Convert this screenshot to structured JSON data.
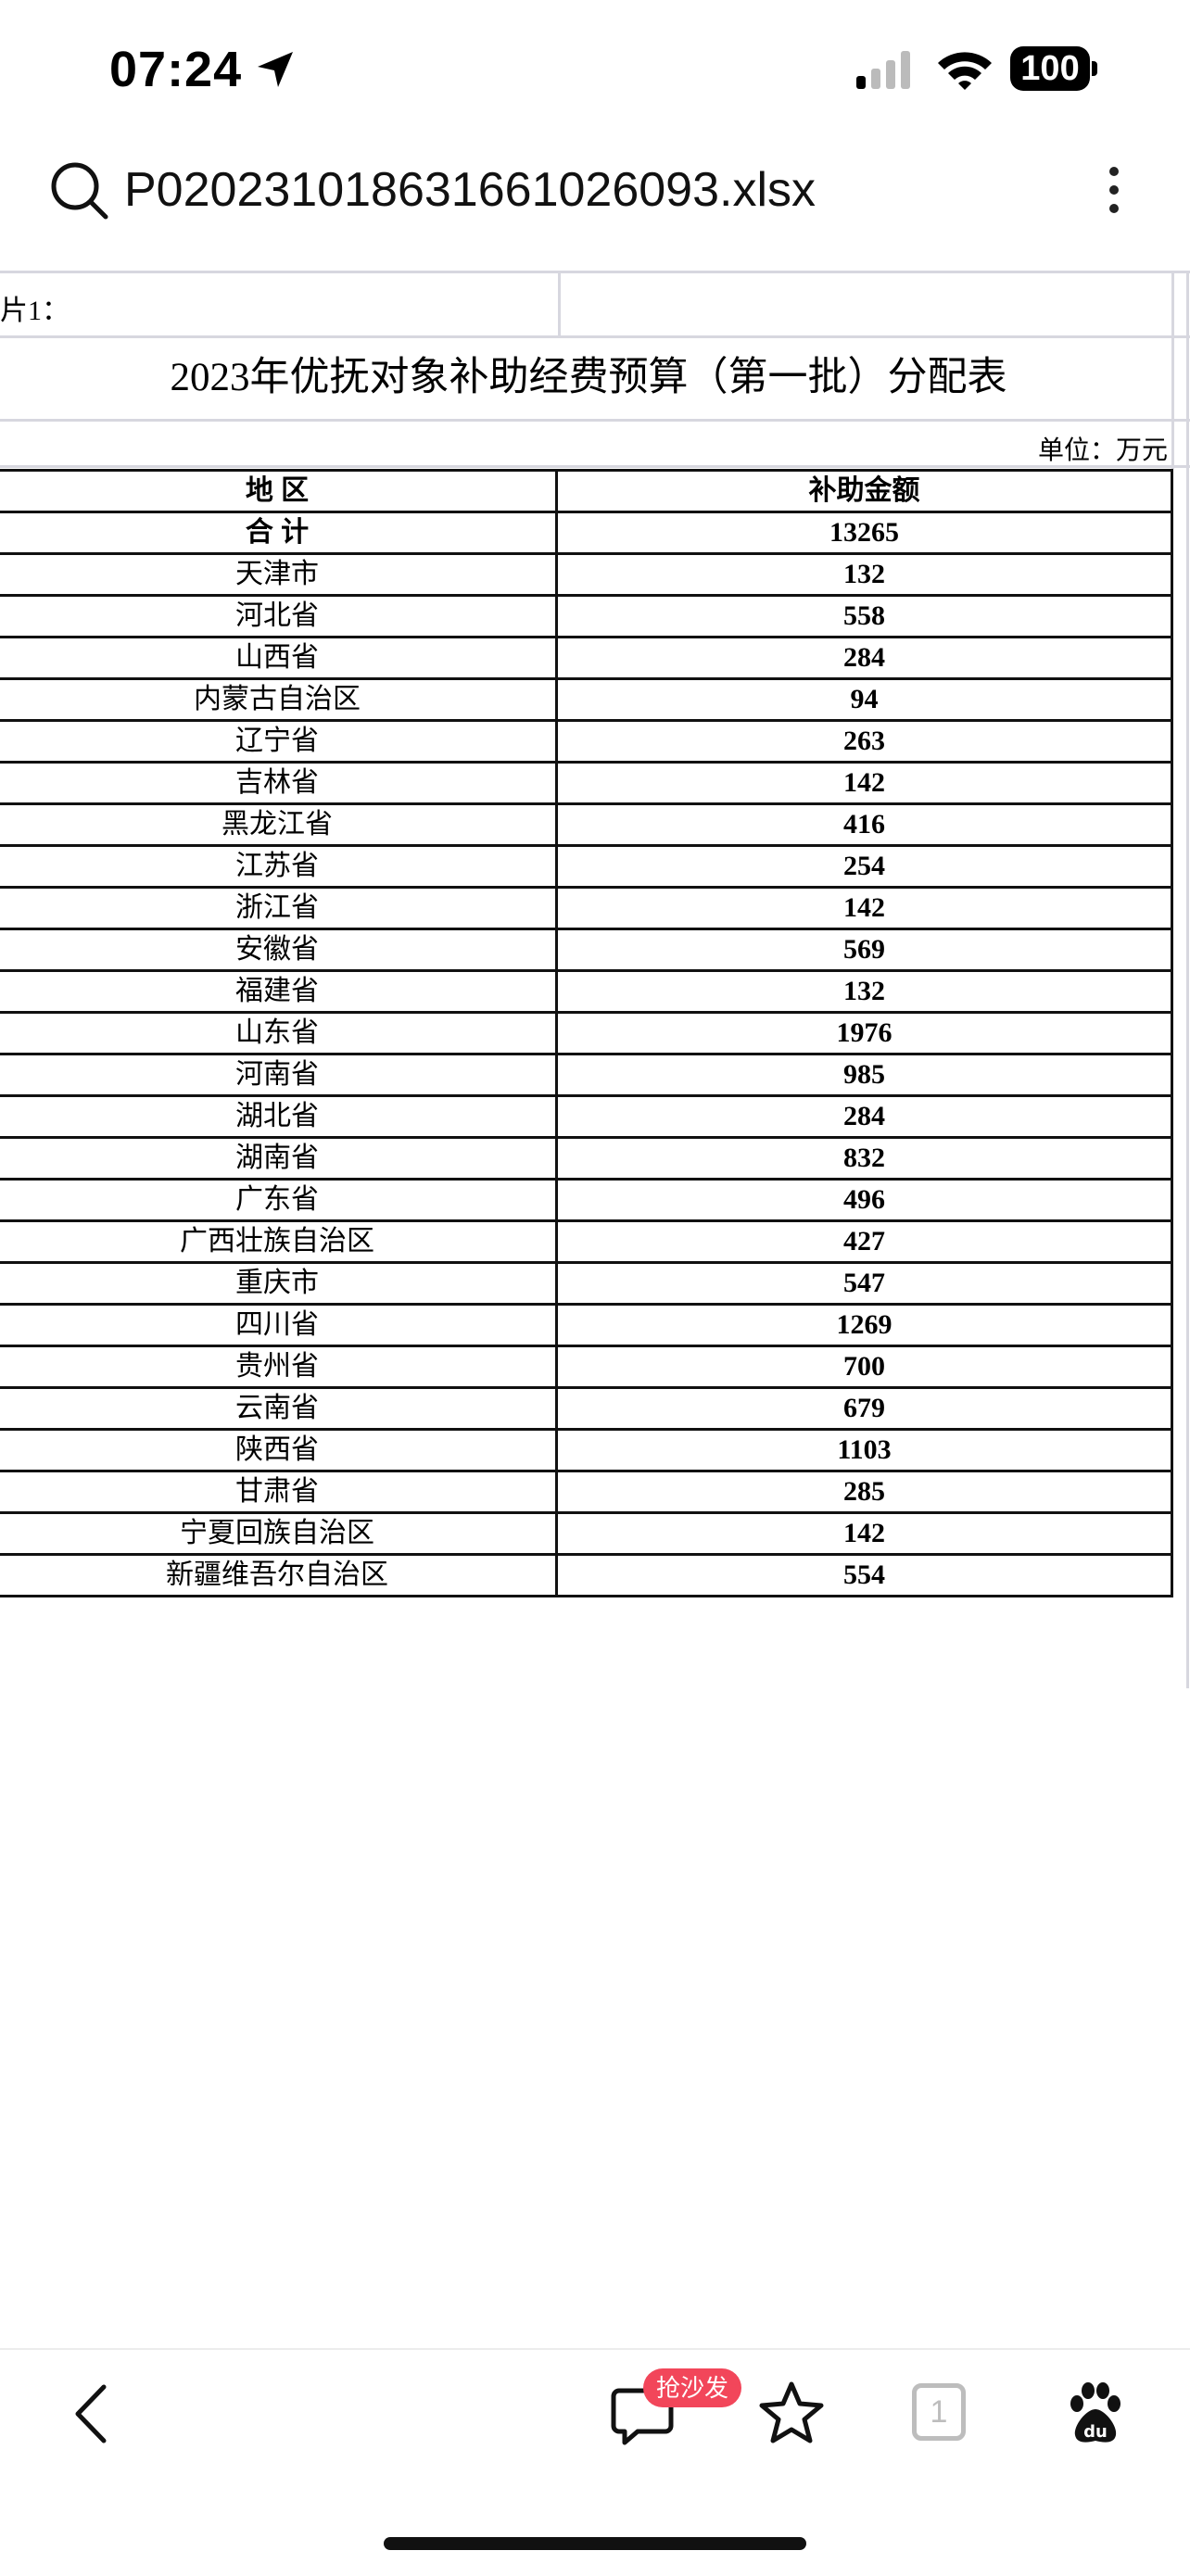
{
  "status_bar": {
    "time": "07:24",
    "battery": "100"
  },
  "address_bar": {
    "file_name": "P020231018631661026093.xlsx"
  },
  "sheet": {
    "note": "⽚1：",
    "title": "2023年优抚对象补助经费预算（第一批）分配表",
    "unit": "单位：万元",
    "headers": [
      "地 区",
      "补助金额"
    ],
    "total": {
      "label": "合 计",
      "value": "13265"
    },
    "rows": [
      {
        "region": "天津市",
        "amount": "132"
      },
      {
        "region": "河北省",
        "amount": "558"
      },
      {
        "region": "山西省",
        "amount": "284"
      },
      {
        "region": "内蒙古自治区",
        "amount": "94"
      },
      {
        "region": "辽宁省",
        "amount": "263"
      },
      {
        "region": "吉林省",
        "amount": "142"
      },
      {
        "region": "黑龙江省",
        "amount": "416"
      },
      {
        "region": "江苏省",
        "amount": "254"
      },
      {
        "region": "浙江省",
        "amount": "142"
      },
      {
        "region": "安徽省",
        "amount": "569"
      },
      {
        "region": "福建省",
        "amount": "132"
      },
      {
        "region": "山东省",
        "amount": "1976"
      },
      {
        "region": "河南省",
        "amount": "985"
      },
      {
        "region": "湖北省",
        "amount": "284"
      },
      {
        "region": "湖南省",
        "amount": "832"
      },
      {
        "region": "广东省",
        "amount": "496"
      },
      {
        "region": "广西壮族自治区",
        "amount": "427"
      },
      {
        "region": "重庆市",
        "amount": "547"
      },
      {
        "region": "四川省",
        "amount": "1269"
      },
      {
        "region": "贵州省",
        "amount": "700"
      },
      {
        "region": "云南省",
        "amount": "679"
      },
      {
        "region": "陕西省",
        "amount": "1103"
      },
      {
        "region": "甘肃省",
        "amount": "285"
      },
      {
        "region": "宁夏回族自治区",
        "amount": "142"
      },
      {
        "region": "新疆维吾尔自治区",
        "amount": "554"
      }
    ]
  },
  "toolbar": {
    "badge": "抢沙发",
    "tab_count": "1",
    "icons": [
      "back-icon",
      "comment-icon",
      "star-icon",
      "tabs-icon",
      "baidu-paw-icon"
    ]
  },
  "colors": {
    "badge": "#f2465a",
    "grid": "#d7d7df"
  }
}
